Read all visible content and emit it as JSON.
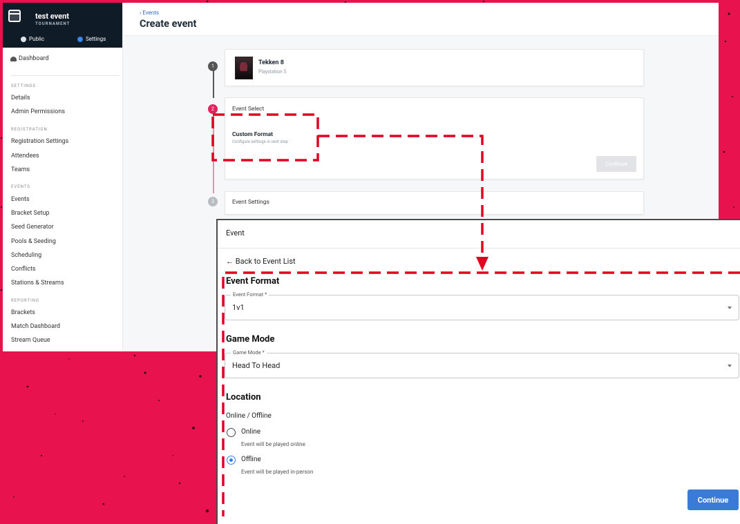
{
  "app": {
    "event_name": "test event",
    "event_type": "TOURNAMENT",
    "tab_public": "Public",
    "tab_settings": "Settings"
  },
  "sidebar": {
    "dashboard": "Dashboard",
    "sections": [
      {
        "title": "SETTINGS",
        "items": [
          "Details",
          "Admin Permissions"
        ]
      },
      {
        "title": "REGISTRATION",
        "items": [
          "Registration Settings",
          "Attendees",
          "Teams"
        ]
      },
      {
        "title": "EVENTS",
        "items": [
          "Events",
          "Bracket Setup",
          "Seed Generator",
          "Pools & Seeding",
          "Scheduling",
          "Conflicts",
          "Stations & Streams"
        ]
      },
      {
        "title": "REPORTING",
        "items": [
          "Brackets",
          "Match Dashboard",
          "Stream Queue"
        ]
      }
    ]
  },
  "header": {
    "breadcrumb": "‹ Events",
    "title": "Create event"
  },
  "steps": {
    "s1_num": "1",
    "s2_num": "2",
    "s3_num": "3",
    "game_title": "Tekken 8",
    "game_platform": "Playstation 5",
    "event_select": "Event Select",
    "custom_format_title": "Custom Format",
    "custom_format_sub": "Configure settings in next step",
    "continue_label": "Continue",
    "event_settings": "Event Settings"
  },
  "panel": {
    "title": "Event",
    "back_label": "← Back to Event List",
    "event_format_heading": "Event Format",
    "event_format_label": "Event Format *",
    "event_format_value": "1v1",
    "game_mode_heading": "Game Mode",
    "game_mode_label": "Game Mode *",
    "game_mode_value": "Head To Head",
    "location_heading": "Location",
    "online_offline_label": "Online / Offline",
    "option_online": "Online",
    "option_online_desc": "Event will be played online",
    "option_offline": "Offline",
    "option_offline_desc": "Event will be played in-person",
    "selected_option": "Offline",
    "continue_label": "Continue"
  },
  "colors": {
    "background": "#e8134e",
    "sidebar_header": "#0f1b26",
    "active_step": "#e0245e",
    "primary_button": "#3a7bd8",
    "annotation": "#e00022"
  }
}
